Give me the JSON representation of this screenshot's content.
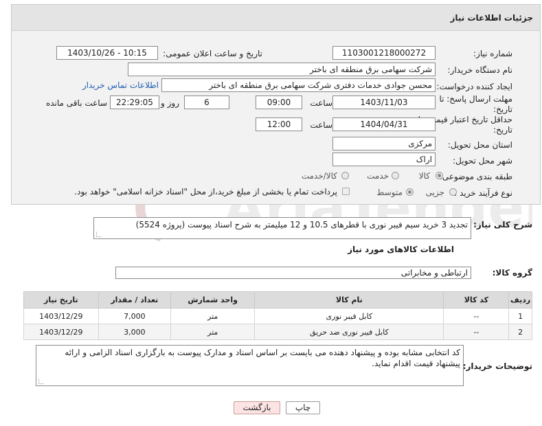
{
  "panel": {
    "title": "جزئیات اطلاعات نیاز"
  },
  "fields": {
    "need_number_label": "شماره نیاز:",
    "need_number": "1103001218000272",
    "announce_label": "تاریخ و ساعت اعلان عمومی:",
    "announce_value": "1403/10/26 - 10:15",
    "buyer_org_label": "نام دستگاه خریدار:",
    "buyer_org": "شرکت سهامی برق منطقه ای باختر",
    "requester_label": "ایجاد کننده درخواست:",
    "requester": "محسن جوادی خدمات دفتری شرکت سهامی برق منطقه ای باختر",
    "contact_link": "اطلاعات تماس خریدار",
    "reply_deadline_label_1": "مهلت ارسال پاسخ: تا",
    "reply_deadline_label_2": "تاریخ:",
    "reply_date": "1403/11/03",
    "time_label": "ساعت",
    "reply_time": "09:00",
    "days_value": "6",
    "days_label": "روز و",
    "remaining_time": "22:29:05",
    "remaining_label": "ساعت باقی مانده",
    "price_validity_label_1": "حداقل تاریخ اعتبار قیمت: تا",
    "price_validity_label_2": "تاریخ:",
    "price_validity_date": "1404/04/31",
    "price_validity_time": "12:00",
    "province_label": "استان محل تحویل:",
    "province": "مرکزی",
    "city_label": "شهر محل تحویل:",
    "city": "اراک",
    "category_label": "طبقه بندی موضوعی:",
    "category_options": [
      "کالا",
      "خدمت",
      "کالا/خدمت"
    ],
    "process_label": "نوع فرآیند خرید :",
    "process_options": [
      "جزیی",
      "متوسط"
    ],
    "payment_note": "پرداخت تمام یا بخشی از مبلغ خرید،از محل \"اسناد خزانه اسلامی\" خواهد بود."
  },
  "summary": {
    "label": "شرح کلی نیاز:",
    "text": "تجدید 3 خرید سیم فیبر نوری با قطرهای 10.5 و 12 میلیمتر به شرح اسناد پیوست (پروژه 5524)"
  },
  "goods": {
    "section_title": "اطلاعات کالاهای مورد نیاز",
    "group_label": "گروه کالا:",
    "group_value": "ارتباطی و مخابراتی",
    "columns": [
      "ردیف",
      "کد کالا",
      "نام کالا",
      "واحد شمارش",
      "تعداد / مقدار",
      "تاریخ نیاز"
    ],
    "rows": [
      [
        "1",
        "--",
        "کابل فیبر نوری",
        "متر",
        "7,000",
        "1403/12/29"
      ],
      [
        "2",
        "--",
        "کابل فیبر نوری ضد حریق",
        "متر",
        "3,000",
        "1403/12/29"
      ]
    ]
  },
  "buyer_notes": {
    "label": "توضیحات خریدار:",
    "text": "کد انتخابی مشابه بوده و پیشنهاد دهنده می بایست بر اساس اسناد و مدارک پیوست به بارگزاری اسناد الزامی و ارائه پیشنهاد قیمت اقدام نماید."
  },
  "buttons": {
    "print": "چاپ",
    "back": "بازگشت"
  },
  "colors": {
    "link": "#1f5fb0",
    "back_button_bg": "#fde4e4",
    "header_bg": "#e4e4e4"
  }
}
